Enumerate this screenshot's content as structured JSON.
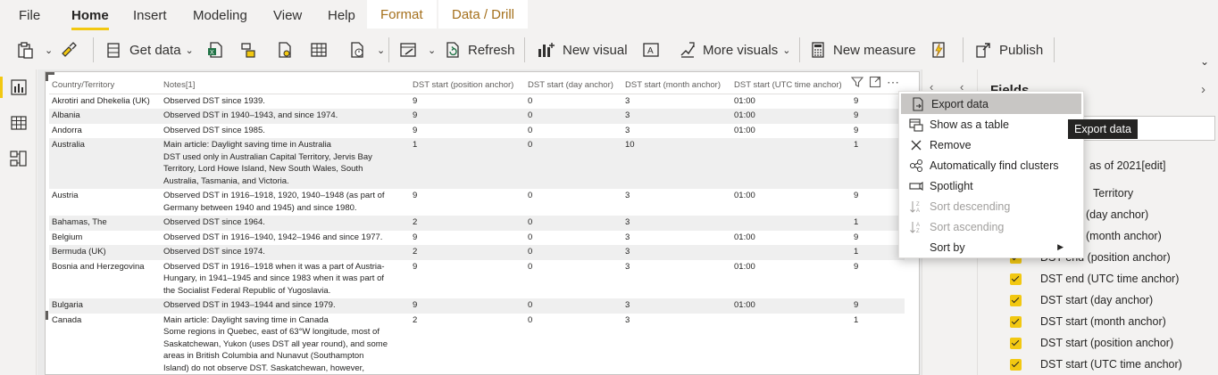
{
  "menu": {
    "file": "File",
    "home": "Home",
    "insert": "Insert",
    "modeling": "Modeling",
    "view": "View",
    "help": "Help",
    "format": "Format",
    "data_drill": "Data / Drill"
  },
  "ribbon": {
    "get_data": "Get data",
    "refresh": "Refresh",
    "new_visual": "New visual",
    "more_visuals": "More visuals",
    "new_measure": "New measure",
    "publish": "Publish"
  },
  "table": {
    "columns": [
      "Country/Territory",
      "Notes[1]",
      "DST start (position anchor)",
      "DST start (day anchor)",
      "DST start (month anchor)",
      "DST start (UTC time anchor)",
      "p"
    ],
    "rows": [
      {
        "country": "Akrotiri and Dhekelia (UK)",
        "notes": "Observed DST since 1939.",
        "pos": "9",
        "day": "0",
        "month": "3",
        "utc": "01:00",
        "p": "9"
      },
      {
        "country": "Albania",
        "notes": "Observed DST in 1940–1943, and since 1974.",
        "pos": "9",
        "day": "0",
        "month": "3",
        "utc": "01:00",
        "p": "9"
      },
      {
        "country": "Andorra",
        "notes": "Observed DST since 1985.",
        "pos": "9",
        "day": "0",
        "month": "3",
        "utc": "01:00",
        "p": "9"
      },
      {
        "country": "Australia",
        "notes": "Main article: Daylight saving time in Australia\nDST used only in  Australian Capital Territory,  Jervis Bay\nTerritory,  Lord Howe Island,  New South Wales,  South\nAustralia,  Tasmania, and  Victoria.",
        "pos": "1",
        "day": "0",
        "month": "10",
        "utc": "",
        "p": "1"
      },
      {
        "country": "Austria",
        "notes": "Observed DST in 1916–1918, 1920, 1940–1948 (as part of\nGermany between 1940 and 1945) and since 1980.",
        "pos": "9",
        "day": "0",
        "month": "3",
        "utc": "01:00",
        "p": "9"
      },
      {
        "country": "Bahamas, The",
        "notes": "Observed DST since 1964.",
        "pos": "2",
        "day": "0",
        "month": "3",
        "utc": "",
        "p": "1"
      },
      {
        "country": "Belgium",
        "notes": "Observed DST in 1916–1940, 1942–1946 and since 1977.",
        "pos": "9",
        "day": "0",
        "month": "3",
        "utc": "01:00",
        "p": "9"
      },
      {
        "country": "Bermuda (UK)",
        "notes": "Observed DST since 1974.",
        "pos": "2",
        "day": "0",
        "month": "3",
        "utc": "",
        "p": "1"
      },
      {
        "country": "Bosnia and Herzegovina",
        "notes": "Observed DST in 1916–1918 when it was a part of  Austria-\nHungary, in 1941–1945 and since 1983 when it was part of\nthe  Socialist Federal Republic of Yugoslavia.",
        "pos": "9",
        "day": "0",
        "month": "3",
        "utc": "01:00",
        "p": "9"
      },
      {
        "country": "Bulgaria",
        "notes": "Observed DST in 1943–1944 and since 1979.",
        "pos": "9",
        "day": "0",
        "month": "3",
        "utc": "01:00",
        "p": "9"
      },
      {
        "country": "Canada",
        "notes": "Main article: Daylight saving time in Canada\nSome regions in  Quebec, east of 63°W longitude, most of\n Saskatchewan,  Yukon (uses DST all year round), and some\nareas in  British Columbia and  Nunavut (Southampton\nIsland) do not observe DST. Saskatchewan, however,\nobserves Central Time even though it geographically",
        "pos": "2",
        "day": "0",
        "month": "3",
        "utc": "",
        "p": "1"
      }
    ]
  },
  "context_menu": {
    "export_data": "Export data",
    "show_as_table": "Show as a table",
    "remove": "Remove",
    "find_clusters": "Automatically find clusters",
    "spotlight": "Spotlight",
    "sort_descending": "Sort descending",
    "sort_ascending": "Sort ascending",
    "sort_by": "Sort by"
  },
  "tooltip": "Export data",
  "fields": {
    "title": "Fields",
    "table_name": "as of 2021[edit]",
    "items": [
      "Territory",
      "(day anchor)",
      "(month anchor)",
      "DST end (position anchor)",
      "DST end (UTC time anchor)",
      "DST start (day anchor)",
      "DST start (month anchor)",
      "DST start (position anchor)",
      "DST start (UTC time anchor)"
    ]
  },
  "colors": {
    "accent": "#f2c811",
    "context_tab_text": "#a5701c",
    "tooltip_bg": "#252423"
  }
}
